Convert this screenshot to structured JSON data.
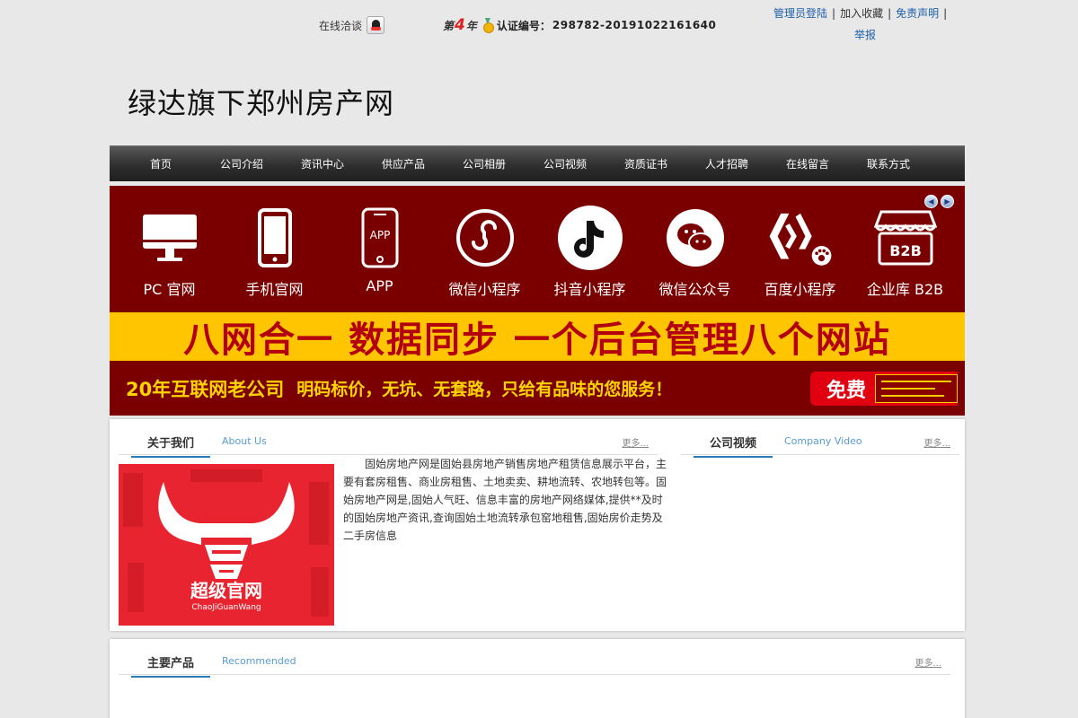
{
  "topbar": {
    "online_chat_label": "在线洽谈",
    "year_prefix": "第",
    "year_num": "4",
    "year_suffix": "年",
    "cert_label": "认证编号：",
    "cert_number": "298782-20191022161640",
    "links": {
      "admin_login": "管理员登陆",
      "add_favorite": "加入收藏",
      "disclaimer": "免责声明",
      "report": "举报"
    },
    "separator": "|"
  },
  "site": {
    "title": "绿达旗下郑州房产网"
  },
  "nav": {
    "items": [
      "首页",
      "公司介绍",
      "资讯中心",
      "供应产品",
      "公司相册",
      "公司视频",
      "资质证书",
      "人才招聘",
      "在线留言",
      "联系方式"
    ]
  },
  "banner": {
    "prev_arrow": "◀",
    "next_arrow": "▶",
    "icons": [
      {
        "label": "PC 官网",
        "icon": "monitor-icon"
      },
      {
        "label": "手机官网",
        "icon": "mobile-phone-icon"
      },
      {
        "label": "APP",
        "icon": "app-phone-icon",
        "inner_text": "APP"
      },
      {
        "label": "微信小程序",
        "icon": "wechat-miniprogram-icon"
      },
      {
        "label": "抖音小程序",
        "icon": "douyin-icon"
      },
      {
        "label": "微信公众号",
        "icon": "wechat-icon"
      },
      {
        "label": "百度小程序",
        "icon": "baidu-miniprogram-icon"
      },
      {
        "label": "企业库 B2B",
        "icon": "b2b-store-icon",
        "inner_text": "B2B"
      }
    ],
    "slogan": "八网合一  数据同步  一个后台管理八个网站",
    "years_text": "20年互联网老公司",
    "promise_text": "明码标价，无坑、无套路，只给有品味的您服务！",
    "free_text": "免费",
    "colors": {
      "background": "#7a0000",
      "band": "#ffc600",
      "slogan": "#b3000e",
      "accent": "#ffd400",
      "badge": "#e00010"
    }
  },
  "about": {
    "title": "关于我们",
    "title_en": "About Us",
    "more": "更多...",
    "logo_text": "超级官网",
    "logo_text_en": "ChaoJiGuanWang",
    "description": "固始房地产网是固始县房地产销售房地产租赁信息展示平台，主要有套房租售、商业房租售、土地卖卖、耕地流转、农地转包等。固始房地产网是,固始人气旺、信息丰富的房地产网络媒体,提供**及时的固始房地产资讯,查询固始土地流转承包窑地租售,固始房价走势及二手房信息"
  },
  "video": {
    "title": "公司视频",
    "title_en": "Company Video",
    "more": "更多..."
  },
  "products": {
    "title": "主要产品",
    "title_en": "Recommended",
    "more": "更多..."
  },
  "colors": {
    "link_blue": "#1f5fa8",
    "section_accent": "#2b7bb9",
    "page_bg": "#e8e8e8"
  }
}
